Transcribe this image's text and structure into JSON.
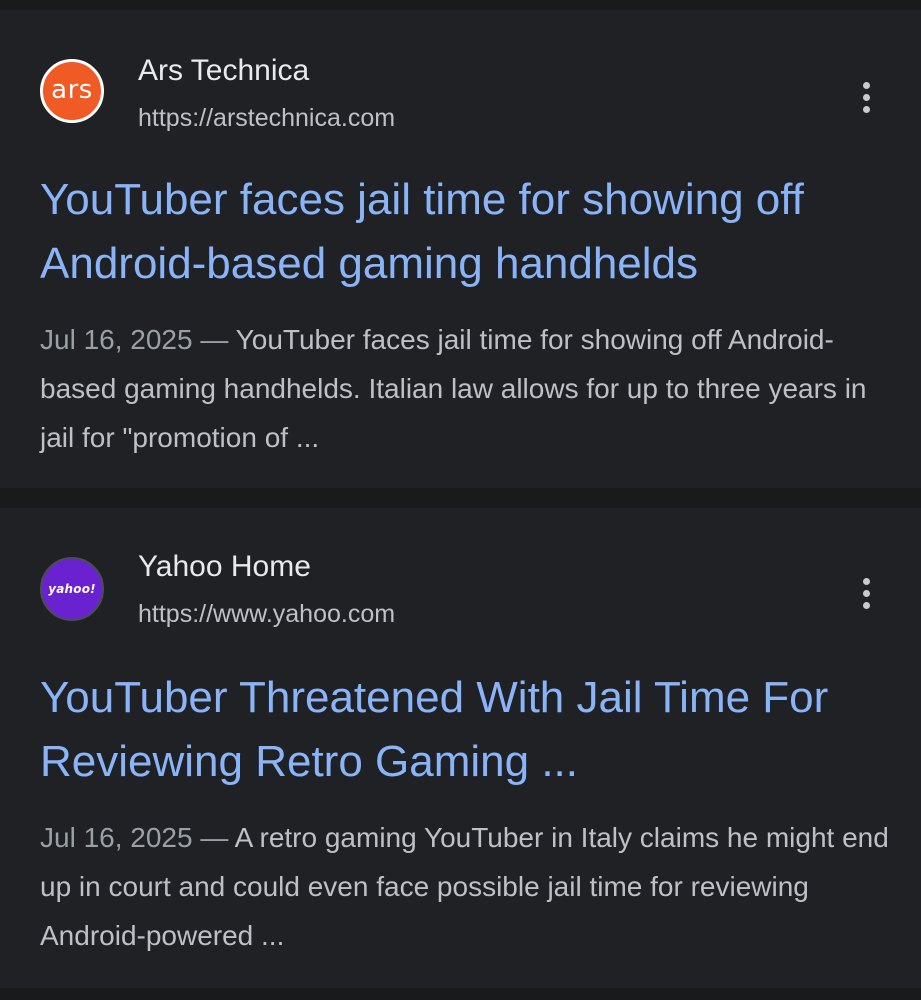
{
  "results": [
    {
      "favicon_text": "ars",
      "favicon_color": "#ef5a25",
      "site_name": "Ars Technica",
      "site_url": "https://arstechnica.com",
      "title": "YouTuber faces jail time for showing off Android-based gaming handhelds",
      "date": "Jul 16, 2025",
      "separator": " — ",
      "snippet": "YouTuber faces jail time for showing off Android-based gaming handhelds. Italian law allows for up to three years in jail for \"promotion of ...",
      "more_icon": "more-vert-icon"
    },
    {
      "favicon_text": "yahoo!",
      "favicon_color": "#6a22d0",
      "site_name": "Yahoo Home",
      "site_url": "https://www.yahoo.com",
      "title": "YouTuber Threatened With Jail Time For Reviewing Retro Gaming ...",
      "date": "Jul 16, 2025",
      "separator": " — ",
      "snippet": "A retro gaming YouTuber in Italy claims he might end up in court and could even face possible jail time for reviewing Android-powered ...",
      "more_icon": "more-vert-icon"
    }
  ],
  "colors": {
    "background": "#191a1c",
    "card": "#202124",
    "link": "#8ab4f8",
    "text_primary": "#e8eaed",
    "text_secondary": "#bdc1c6"
  }
}
